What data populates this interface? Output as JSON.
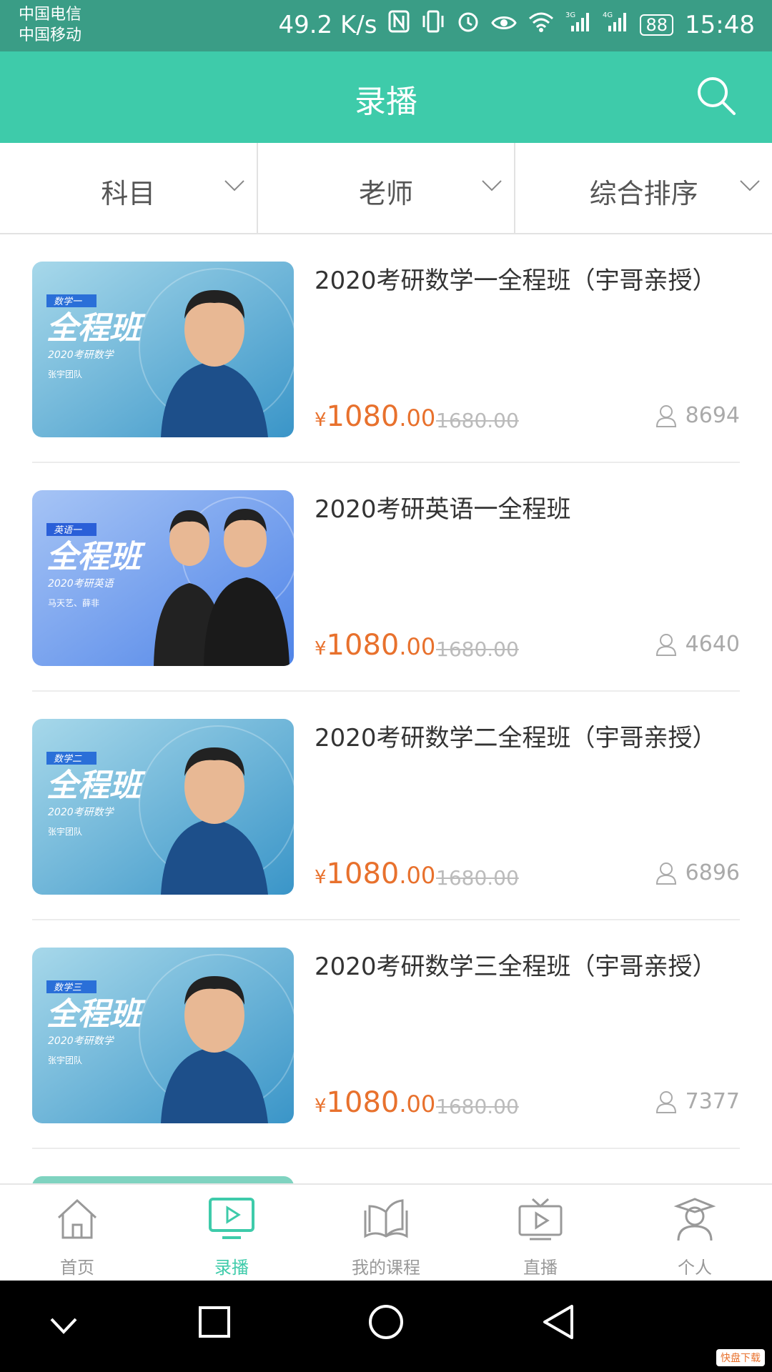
{
  "status_bar": {
    "carrier1": "中国电信",
    "carrier2": "中国移动",
    "speed": "49.2 K/s",
    "battery": "88",
    "time": "15:48",
    "icons": [
      "nfc-icon",
      "vibrate-icon",
      "alarm-icon",
      "eye-icon",
      "wifi-icon",
      "signal-3g-icon",
      "signal-4g-icon",
      "battery-icon"
    ]
  },
  "header": {
    "title": "录播",
    "search_icon": "search-icon"
  },
  "filters": [
    {
      "label": "科目"
    },
    {
      "label": "老师"
    },
    {
      "label": "综合排序"
    }
  ],
  "courses": [
    {
      "title": "2020考研数学一全程班（宇哥亲授）",
      "price_currency": "¥",
      "price_main": "1080",
      "price_cents": ".00",
      "old_price": "1680.00",
      "students": "8694",
      "thumb_tag": "数学一",
      "thumb_title": "全程班",
      "thumb_sub": "2020考研数学",
      "thumb_team": "张宇团队"
    },
    {
      "title": "2020考研英语一全程班",
      "price_currency": "¥",
      "price_main": "1080",
      "price_cents": ".00",
      "old_price": "1680.00",
      "students": "4640",
      "thumb_tag": "英语一",
      "thumb_title": "全程班",
      "thumb_sub": "2020考研英语",
      "thumb_team": "马天艺、薛非"
    },
    {
      "title": "2020考研数学二全程班（宇哥亲授）",
      "price_currency": "¥",
      "price_main": "1080",
      "price_cents": ".00",
      "old_price": "1680.00",
      "students": "6896",
      "thumb_tag": "数学二",
      "thumb_title": "全程班",
      "thumb_sub": "2020考研数学",
      "thumb_team": "张宇团队"
    },
    {
      "title": "2020考研数学三全程班（宇哥亲授）",
      "price_currency": "¥",
      "price_main": "1080",
      "price_cents": ".00",
      "old_price": "1680.00",
      "students": "7377",
      "thumb_tag": "数学三",
      "thumb_title": "全程班",
      "thumb_sub": "2020考研数学",
      "thumb_team": "张宇团队"
    }
  ],
  "tabs": [
    {
      "label": "首页",
      "icon": "home-icon"
    },
    {
      "label": "录播",
      "icon": "video-play-icon",
      "active": true
    },
    {
      "label": "我的课程",
      "icon": "book-icon"
    },
    {
      "label": "直播",
      "icon": "tv-live-icon"
    },
    {
      "label": "个人",
      "icon": "person-icon"
    }
  ],
  "colors": {
    "accent": "#3ecbaa",
    "status": "#3a9d86",
    "price": "#e8712d"
  },
  "watermark": "快盘下载"
}
